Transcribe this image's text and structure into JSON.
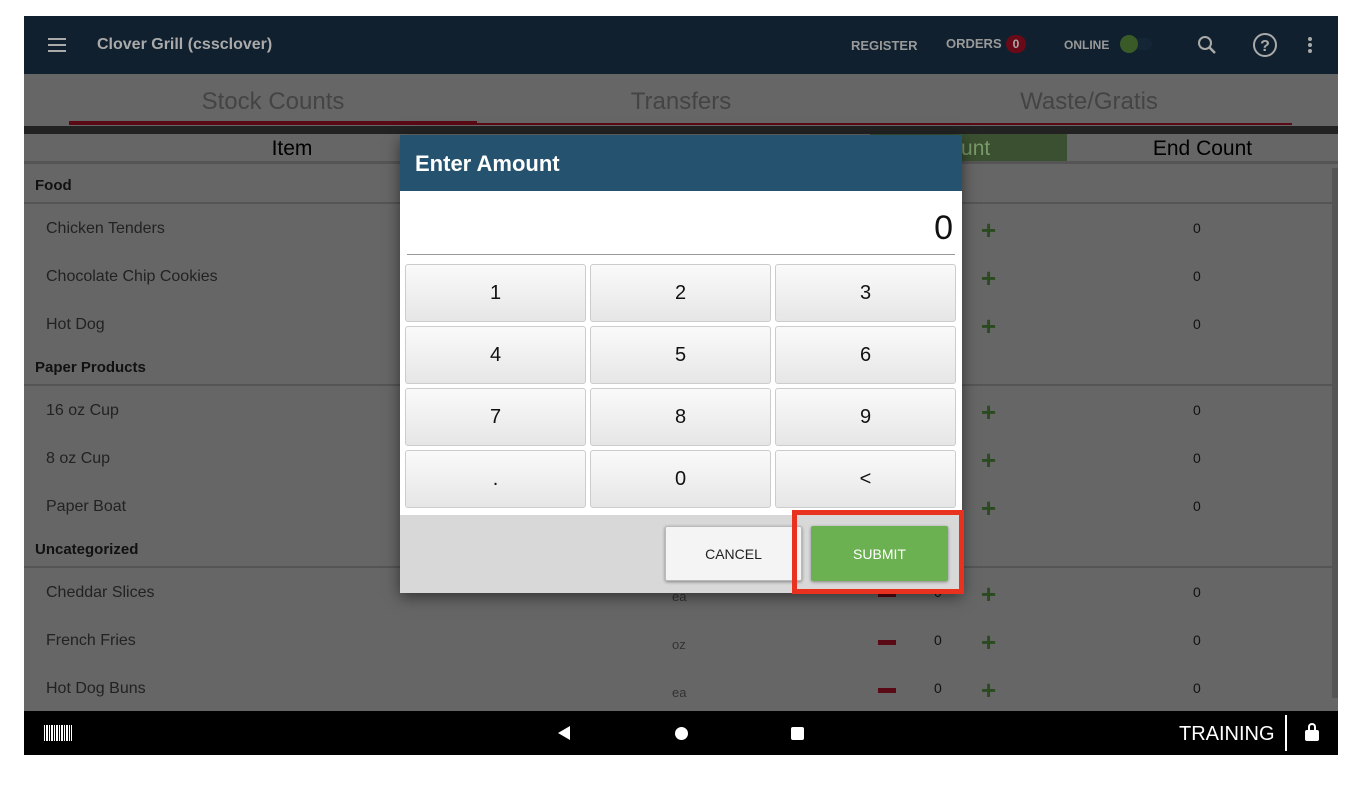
{
  "header": {
    "title": "Clover Grill (cssclover)",
    "register": "REGISTER",
    "orders": "ORDERS",
    "orders_count": "0",
    "online": "ONLINE",
    "online_on": true
  },
  "tabs": [
    {
      "label": "Stock Counts",
      "active": true
    },
    {
      "label": "Transfers"
    },
    {
      "label": "Waste/Gratis"
    }
  ],
  "columns": {
    "item": "Item",
    "start": "Start Count",
    "end": "End Count"
  },
  "sections": [
    {
      "name": "Food",
      "rows": [
        {
          "name": "Chicken Tenders",
          "unit": "",
          "end": "0"
        },
        {
          "name": "Chocolate Chip Cookies",
          "unit": "",
          "end": "0"
        },
        {
          "name": "Hot Dog",
          "unit": "",
          "end": "0"
        }
      ]
    },
    {
      "name": "Paper Products",
      "rows": [
        {
          "name": "16 oz Cup",
          "unit": "",
          "end": "0"
        },
        {
          "name": "8 oz Cup",
          "unit": "",
          "end": "0"
        },
        {
          "name": "Paper Boat",
          "unit": "",
          "end": "0"
        }
      ]
    },
    {
      "name": "Uncategorized",
      "rows": [
        {
          "name": "Cheddar Slices",
          "unit": "ea",
          "start": "0",
          "end": "0"
        },
        {
          "name": "French Fries",
          "unit": "oz",
          "start": "0",
          "end": "0"
        },
        {
          "name": "Hot Dog Buns",
          "unit": "ea",
          "start": "0",
          "end": "0"
        }
      ]
    }
  ],
  "dialog": {
    "title": "Enter Amount",
    "value": "0",
    "keys": [
      "1",
      "2",
      "3",
      "4",
      "5",
      "6",
      "7",
      "8",
      "9",
      ".",
      "0",
      "<"
    ],
    "cancel": "CANCEL",
    "submit": "SUBMIT"
  },
  "navbar": {
    "mode": "TRAINING"
  },
  "colors": {
    "header": "#284f73",
    "accent": "#c0142c",
    "submit": "#6bb152",
    "highlight": "#e8321f"
  }
}
